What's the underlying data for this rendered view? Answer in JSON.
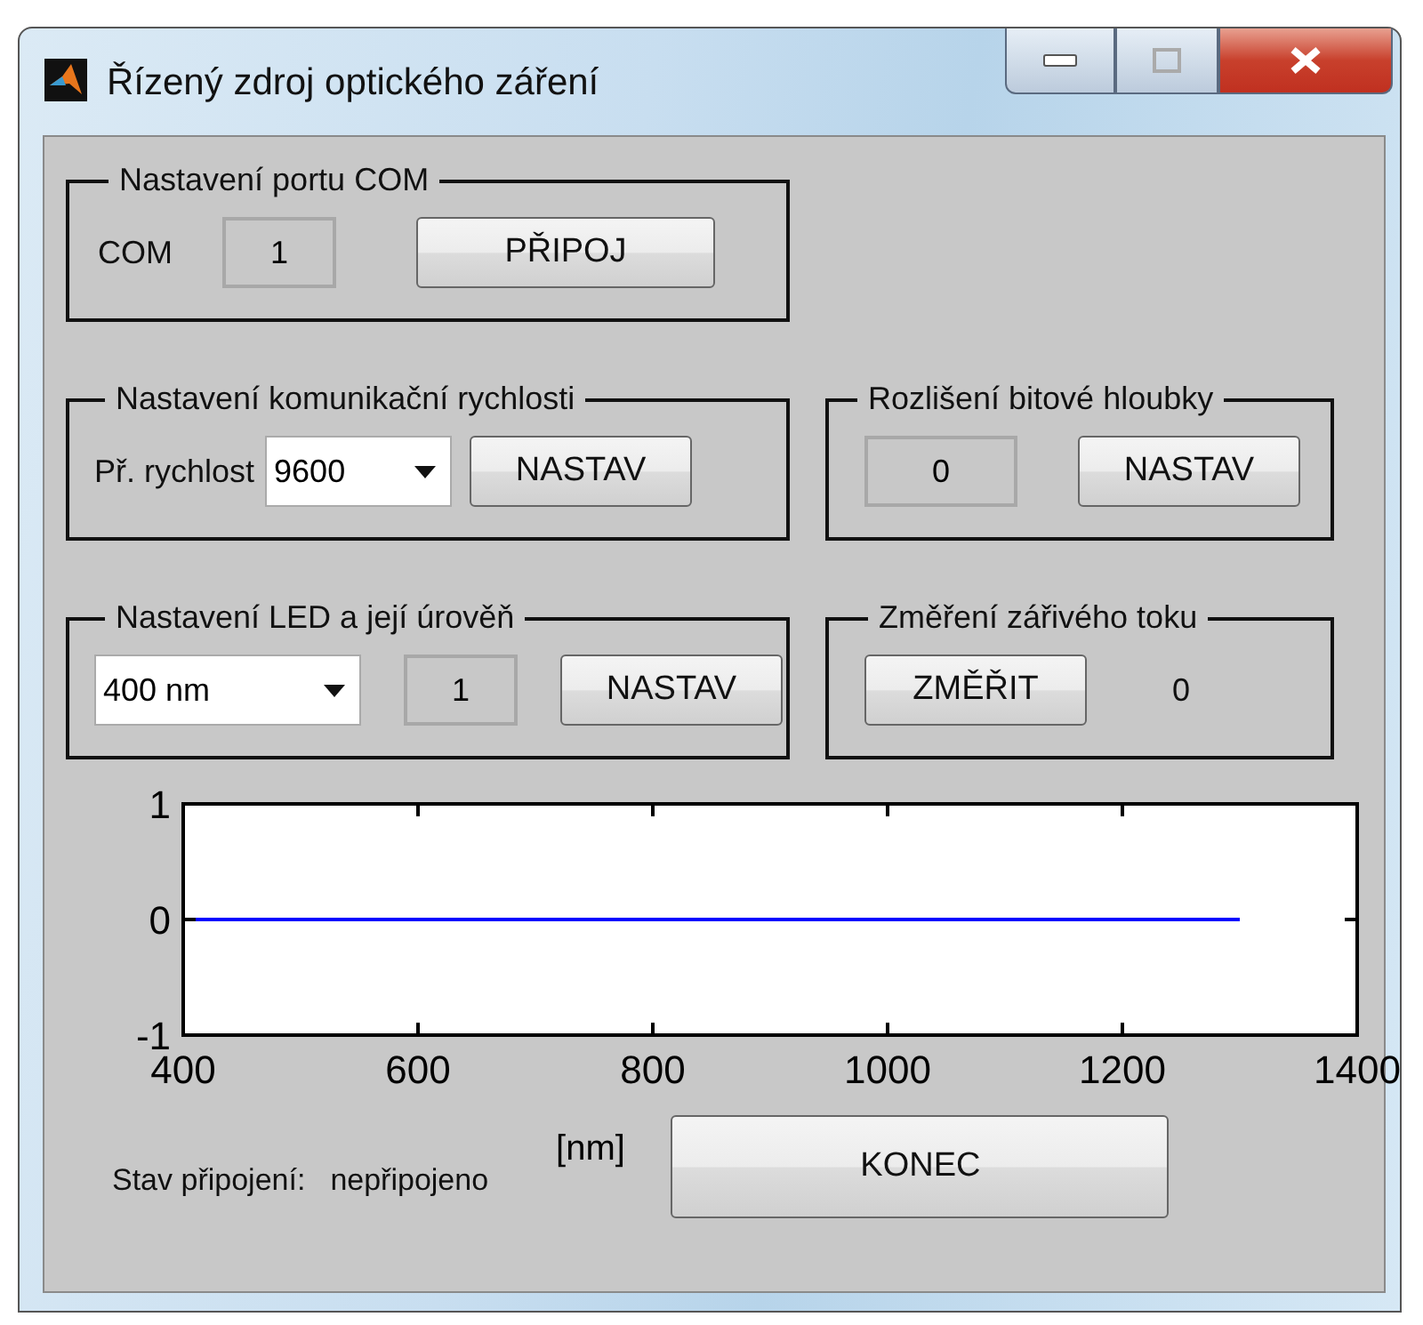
{
  "window": {
    "title": "Řízený zdroj optického záření"
  },
  "com_panel": {
    "title": "Nastavení portu COM",
    "label": "COM",
    "value": "1",
    "button": "PŘIPOJ"
  },
  "speed_panel": {
    "title": "Nastavení komunikační rychlosti",
    "label": "Př. rychlost",
    "value": "9600",
    "button": "NASTAV"
  },
  "depth_panel": {
    "title": "Rozlišení bitové hloubky",
    "value": "0",
    "button": "NASTAV"
  },
  "led_panel": {
    "title": "Nastavení LED a její úrověň",
    "wavelength": "400 nm",
    "value": "1",
    "button": "NASTAV"
  },
  "measure_panel": {
    "title": "Změření zářivého toku",
    "button": "ZMĚŘIT",
    "reading": "0"
  },
  "plot": {
    "chart_data": {
      "type": "line",
      "xlabel": "[nm]",
      "x": [
        400,
        1300
      ],
      "series": [
        {
          "color": "#0000ff",
          "values": [
            0,
            0
          ]
        }
      ],
      "xlim": [
        400,
        1400
      ],
      "ylim": [
        -1,
        1
      ],
      "xticks": [
        400,
        600,
        800,
        1000,
        1200,
        1400
      ],
      "yticks": [
        -1,
        0,
        1
      ]
    }
  },
  "status": {
    "label": "Stav připojení:",
    "value": "nepřipojeno"
  },
  "buttons": [
    "KONEC"
  ]
}
